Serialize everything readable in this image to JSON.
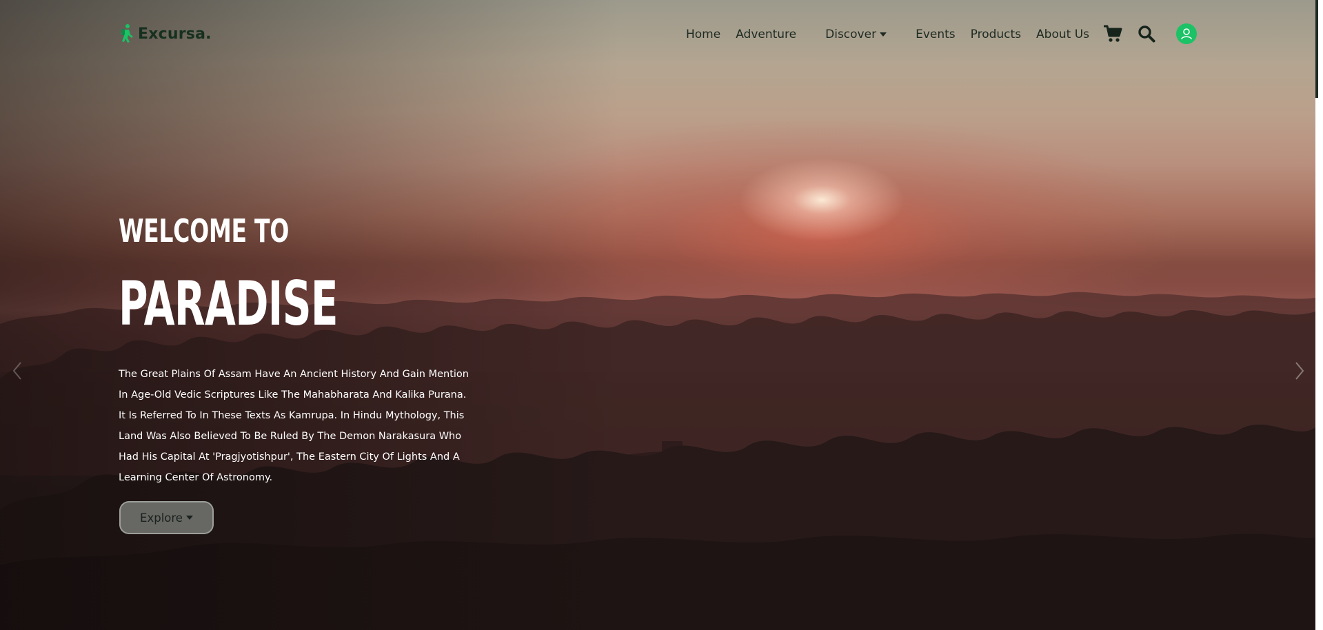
{
  "brand": {
    "name": "Excursa.",
    "icon": "hiker-icon",
    "color": "#1bc266"
  },
  "nav": {
    "items": [
      {
        "label": "Home"
      },
      {
        "label": "Adventure"
      },
      {
        "label": "Discover",
        "dropdown": true
      },
      {
        "label": "Events"
      },
      {
        "label": "Products"
      },
      {
        "label": "About Us"
      }
    ],
    "icons": [
      "cart-icon",
      "search-icon",
      "user-profile-icon"
    ]
  },
  "hero": {
    "welcome": "WELCOME TO",
    "title": "PARADISE",
    "description": "The Great Plains Of Assam Have An Ancient History And Gain Mention In Age-Old Vedic Scriptures Like The Mahabharata And Kalika Purana. It Is Referred To In These Texts As Kamrupa. In Hindu Mythology, This Land Was Also Believed To Be Ruled By The Demon Narakasura Who Had His Capital At 'Pragjyotishpur', The Eastern City Of Lights And A Learning Center Of Astronomy.",
    "explore_label": "Explore",
    "carousel_controls": [
      "chevron-left-icon",
      "chevron-right-icon"
    ]
  },
  "colors": {
    "accent": "#1bc266",
    "nav_text": "#1d2a22",
    "hero_text": "#ffffff"
  }
}
